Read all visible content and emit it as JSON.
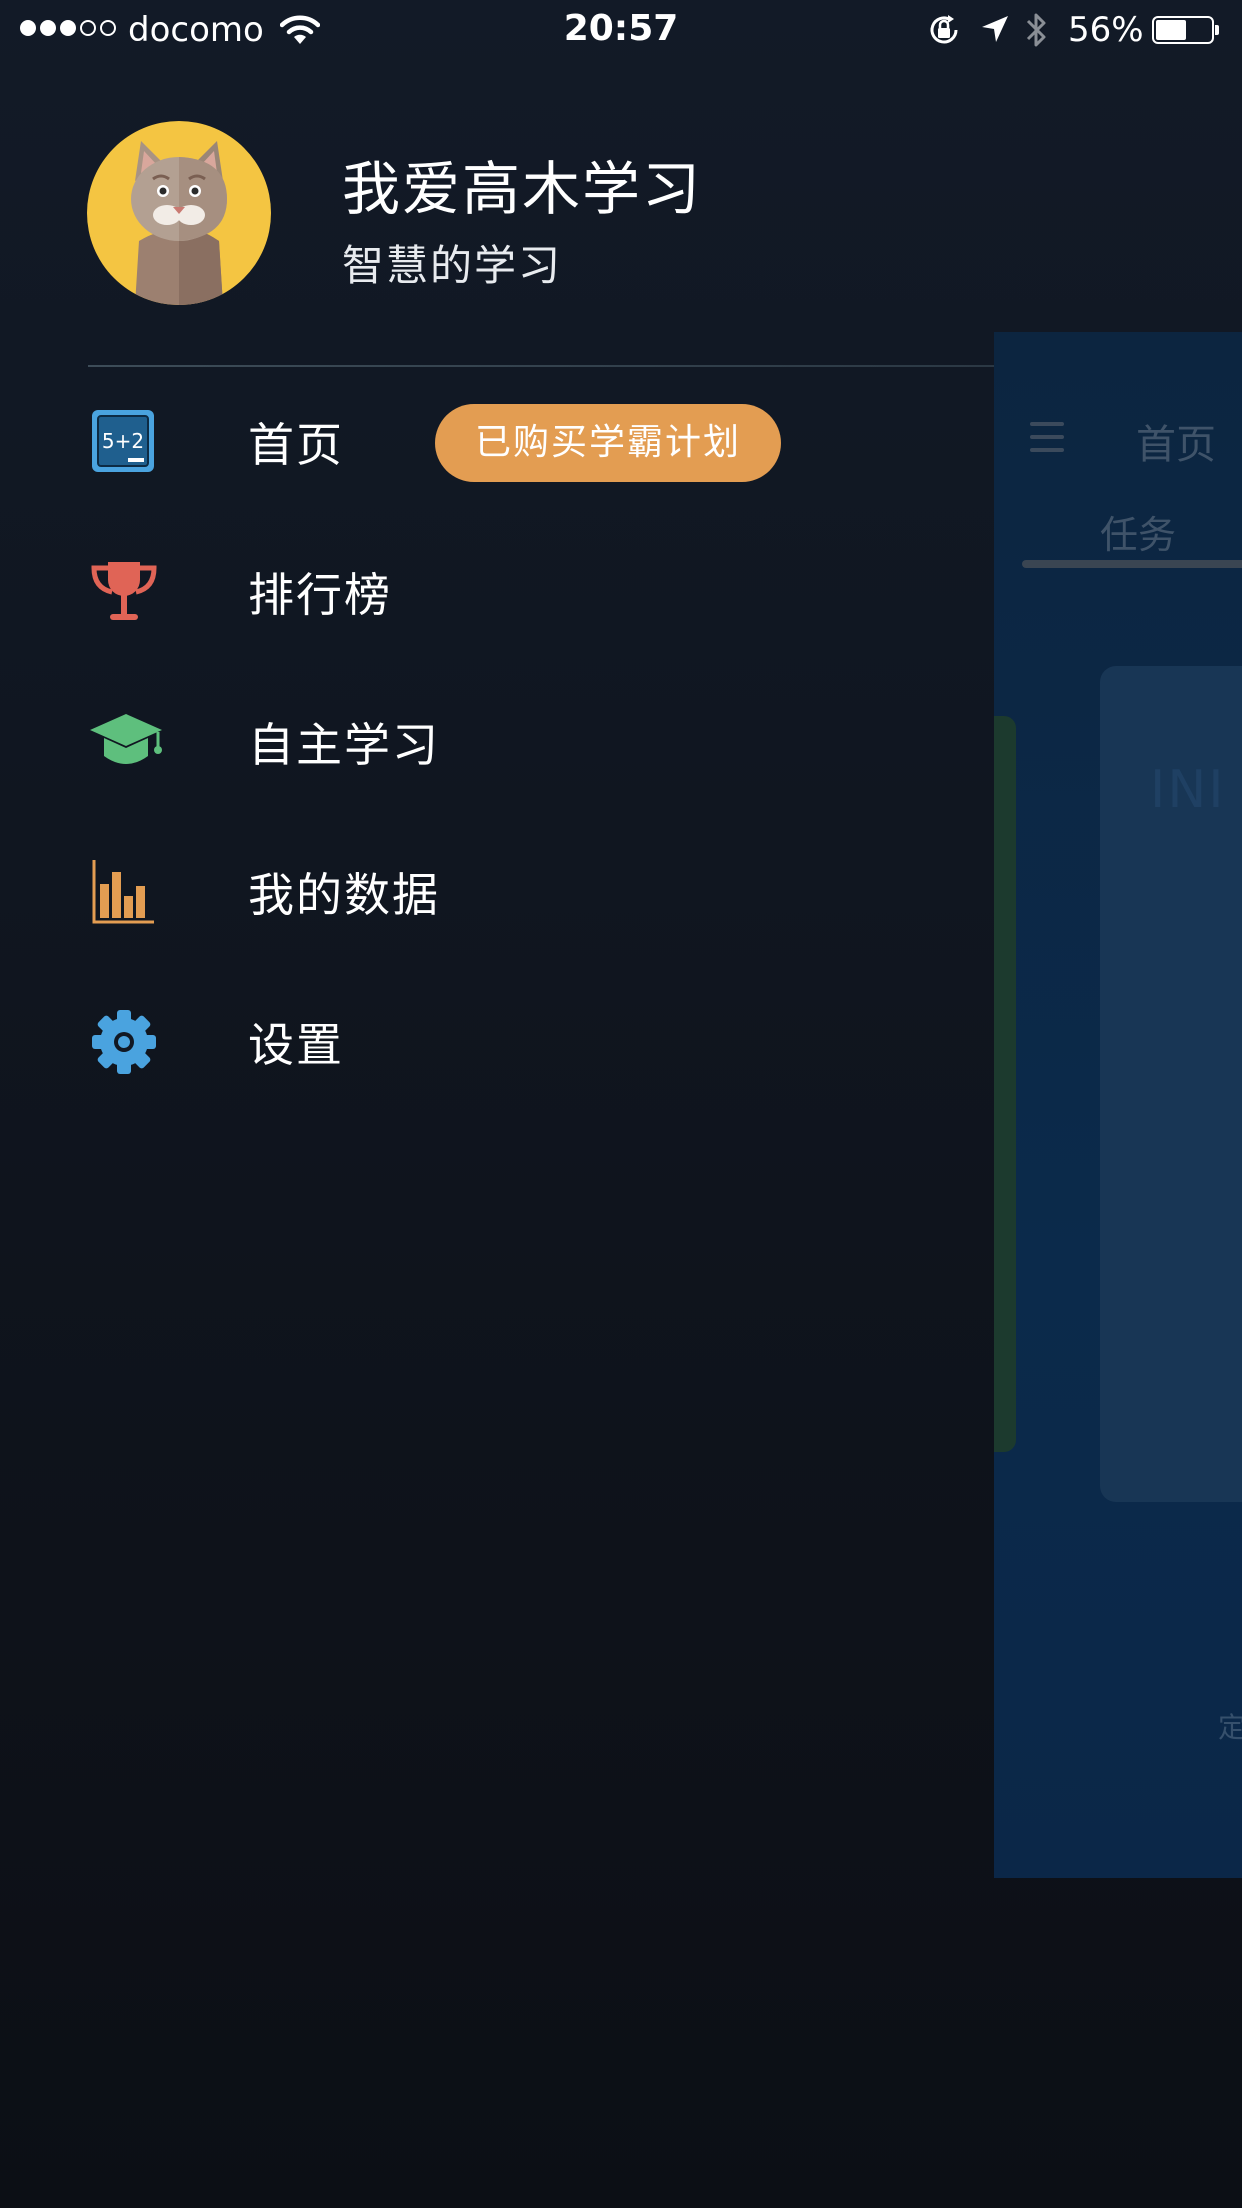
{
  "status_bar": {
    "carrier": "docomo",
    "signal_bars_filled": 3,
    "signal_bars_total": 5,
    "time": "20:57",
    "battery_percent_label": "56%",
    "battery_level": 0.56,
    "icons": [
      "wifi-icon",
      "rotation-lock-icon",
      "location-arrow-icon",
      "bluetooth-icon",
      "battery-icon"
    ]
  },
  "drawer": {
    "profile": {
      "name": "我爱高木学习",
      "tagline": "智慧的学习",
      "avatar_icon": "cat-avatar-icon"
    },
    "menu": [
      {
        "label": "首页",
        "icon": "blackboard-icon",
        "icon_color": "#4aa3df",
        "badge": "已购买学霸计划"
      },
      {
        "label": "排行榜",
        "icon": "trophy-icon",
        "icon_color": "#e06456"
      },
      {
        "label": "自主学习",
        "icon": "graduation-cap-icon",
        "icon_color": "#5ebf7d"
      },
      {
        "label": "我的数据",
        "icon": "bar-chart-icon",
        "icon_color": "#e39d52"
      },
      {
        "label": "设置",
        "icon": "gear-icon",
        "icon_color": "#4aa3df"
      }
    ]
  },
  "background_app": {
    "title": "首页",
    "tab": "任务",
    "card_text": "INI",
    "footer_fragment": "定"
  },
  "colors": {
    "drawer_bg": "#121a27",
    "badge_bg": "#e39d52",
    "background_app_bg": "#0b2a4b"
  }
}
